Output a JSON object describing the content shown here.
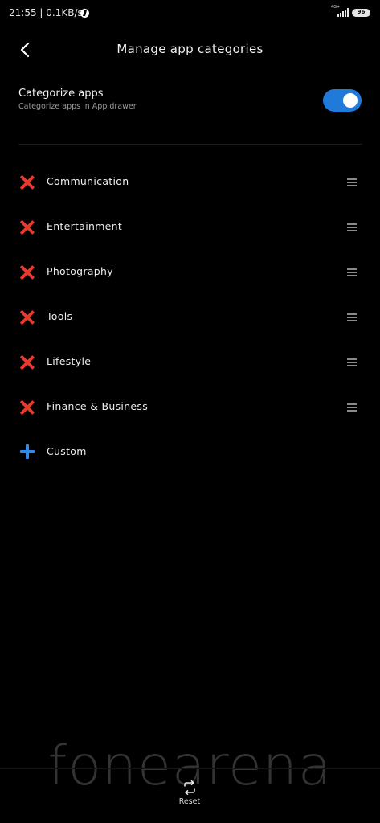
{
  "status_bar": {
    "time": "21:55",
    "speed": "0.1KB/s",
    "network": "4G+",
    "battery": "96"
  },
  "header": {
    "title": "Manage app categories"
  },
  "categorize": {
    "title": "Categorize apps",
    "subtitle": "Categorize apps in App drawer",
    "enabled": true
  },
  "categories": [
    {
      "label": "Communication"
    },
    {
      "label": "Entertainment"
    },
    {
      "label": "Photography"
    },
    {
      "label": "Tools"
    },
    {
      "label": "Lifestyle"
    },
    {
      "label": "Finance & Business"
    }
  ],
  "add_custom": {
    "label": "Custom"
  },
  "footer": {
    "reset_label": "Reset"
  },
  "watermark": "fonearena",
  "colors": {
    "accent": "#1f7ad9",
    "remove": "#e8392c",
    "add": "#2f8de8",
    "background": "#000000"
  }
}
